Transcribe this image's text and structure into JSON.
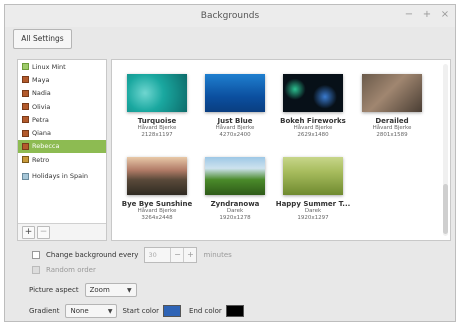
{
  "window": {
    "title": "Backgrounds",
    "controls": {
      "minimize": "−",
      "maximize": "+",
      "close": "×"
    }
  },
  "all_settings_label": "All Settings",
  "sidebar": {
    "items": [
      {
        "label": "Linux Mint",
        "icon": "folder-icon"
      },
      {
        "label": "Maya",
        "icon": "user-folder-icon"
      },
      {
        "label": "Nadia",
        "icon": "user-folder-icon"
      },
      {
        "label": "Olivia",
        "icon": "user-folder-icon"
      },
      {
        "label": "Petra",
        "icon": "user-folder-icon"
      },
      {
        "label": "Qiana",
        "icon": "user-folder-icon"
      },
      {
        "label": "Rebecca",
        "icon": "user-folder-icon",
        "selected": true
      },
      {
        "label": "Retro",
        "icon": "retro-icon"
      },
      {
        "label": "Holidays in Spain",
        "icon": "holiday-icon"
      }
    ],
    "add_label": "+",
    "remove_label": "−"
  },
  "gallery": {
    "thumbnails": [
      {
        "name": "Turquoise",
        "author": "Håvard Bjerke",
        "size": "2128x1197"
      },
      {
        "name": "Just Blue",
        "author": "Håvard Bjerke",
        "size": "4270x2400"
      },
      {
        "name": "Bokeh Fireworks",
        "author": "Håvard Bjerke",
        "size": "2629x1480"
      },
      {
        "name": "Derailed",
        "author": "Håvard Bjerke",
        "size": "2801x1589"
      },
      {
        "name": "Bye Bye Sunshine",
        "author": "Håvard Bjerke",
        "size": "3264x2448"
      },
      {
        "name": "Zyndranowa",
        "author": "Darek",
        "size": "1920x1278"
      },
      {
        "name": "Happy Summer T...",
        "author": "Darek",
        "size": "1920x1297"
      }
    ]
  },
  "controls": {
    "change_every_label": "Change background every",
    "change_every_value": "30",
    "spin_minus": "−",
    "spin_plus": "+",
    "minutes_label": "minutes",
    "random_order_label": "Random order",
    "picture_aspect_label": "Picture aspect",
    "picture_aspect_value": "Zoom",
    "gradient_label": "Gradient",
    "gradient_value": "None",
    "start_color_label": "Start color",
    "start_color": "#2f64b6",
    "end_color_label": "End color",
    "end_color": "#000000"
  }
}
